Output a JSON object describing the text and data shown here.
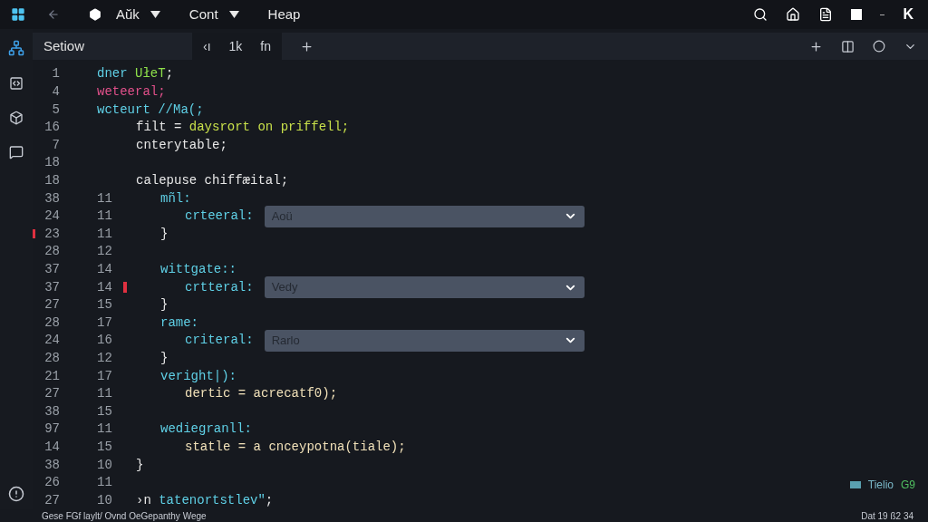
{
  "menu": [
    {
      "label": "Aŭk",
      "caret": true
    },
    {
      "label": "Cont",
      "caret": true
    },
    {
      "label": "Heap",
      "caret": false
    }
  ],
  "window_controls": {
    "close": "K"
  },
  "tabs": [
    {
      "label": "Setiow",
      "selected": false
    }
  ],
  "tab_group": [
    {
      "label": "‹ı"
    },
    {
      "label": "1k"
    },
    {
      "label": "fn"
    }
  ],
  "lines": [
    {
      "n": "1",
      "tokens": [
        {
          "text": "dner ",
          "kind": "keyword"
        },
        {
          "text": "UłeT",
          "kind": "type"
        },
        {
          "text": ";",
          "kind": "plain"
        }
      ]
    },
    {
      "n": "4",
      "tokens": [
        {
          "text": "weteeral;",
          "kind": "accent"
        }
      ]
    },
    {
      "n": "5",
      "tokens": [
        {
          "text": "wcteurt //Ma(;",
          "kind": "keyword"
        }
      ],
      "children": [
        {
          "n": "16",
          "tokens": [
            {
              "text": "filt = ",
              "kind": "plain"
            },
            {
              "text": "daysrort on priffell;",
              "kind": "string"
            }
          ]
        },
        {
          "n": "7",
          "tokens": [
            {
              "text": "cnterytable;",
              "kind": "plain"
            }
          ]
        },
        {
          "n": "18"
        },
        {
          "n": "18",
          "tokens": [
            {
              "text": "calepuse chiffæital;",
              "kind": "plain"
            }
          ],
          "children": [
            {
              "n": "38",
              "n2": "11",
              "tokens": [
                {
                  "text": "mñl:",
                  "kind": "keyword"
                }
              ],
              "children": [
                {
                  "n": "24",
                  "n2": "11",
                  "tokens": [
                    {
                      "text": "crteeral:",
                      "kind": "keyword"
                    }
                  ],
                  "dropdown": {
                    "value": "Aoü"
                  }
                }
              ]
            },
            {
              "n": "23",
              "n2": "11",
              "tokens": [
                {
                  "text": "}",
                  "kind": "plain"
                }
              ],
              "marker": {
                "kind": "gutter"
              }
            },
            {
              "n": "28",
              "n2": "12"
            },
            {
              "n": "37",
              "n2": "14",
              "tokens": [
                {
                  "text": "wittgate::",
                  "kind": "keyword"
                }
              ],
              "children": [
                {
                  "n": "37",
                  "n2": "14",
                  "tokens": [
                    {
                      "text": "crtteral:",
                      "kind": "keyword"
                    }
                  ],
                  "dropdown": {
                    "value": "Vedy"
                  },
                  "marker": {
                    "kind": "inline"
                  }
                }
              ]
            },
            {
              "n": "27",
              "n2": "15",
              "tokens": [
                {
                  "text": "}",
                  "kind": "plain"
                }
              ]
            },
            {
              "n": "28",
              "n2": "17",
              "tokens": [
                {
                  "text": "rame:",
                  "kind": "keyword"
                }
              ],
              "children": [
                {
                  "n": "24",
                  "n2": "16",
                  "tokens": [
                    {
                      "text": "criteral:",
                      "kind": "keyword"
                    }
                  ],
                  "dropdown": {
                    "value": "Rarlo"
                  }
                }
              ]
            },
            {
              "n": "28",
              "n2": "12",
              "tokens": [
                {
                  "text": "}",
                  "kind": "plain"
                }
              ]
            },
            {
              "n": "21",
              "n2": "17",
              "tokens": [
                {
                  "text": "veright|):",
                  "kind": "keyword"
                }
              ],
              "children": [
                {
                  "n": "27",
                  "n2": "11",
                  "tokens": [
                    {
                      "text": "dertic = acrecatf0);",
                      "kind": "value"
                    }
                  ]
                }
              ]
            },
            {
              "n": "38",
              "n2": "15"
            },
            {
              "n": "97",
              "n2": "11",
              "tokens": [
                {
                  "text": "wediegranll:",
                  "kind": "keyword"
                }
              ],
              "children": [
                {
                  "n": "14",
                  "n2": "15",
                  "tokens": [
                    {
                      "text": "statle = a cnceypotna(tiale);",
                      "kind": "value"
                    }
                  ]
                }
              ]
            }
          ]
        },
        {
          "n": "38",
          "n2": "10",
          "tokens": [
            {
              "text": "}",
              "kind": "plain"
            }
          ]
        },
        {
          "n": "26",
          "n2": "11"
        },
        {
          "n": "27",
          "n2": "10",
          "tokens": [
            {
              "text": "›n ",
              "kind": "plain"
            },
            {
              "text": "tatenortstlev\"",
              "kind": "keyword"
            },
            {
              "text": ";",
              "kind": "plain"
            }
          ]
        }
      ]
    }
  ],
  "status_indicator": {
    "label": "Tielio",
    "count": "G9"
  },
  "status_bar": {
    "left": "Gese FGf laylt/ Ovnd OeGepanthy Wege",
    "right": "Dat 19 ß2 34"
  }
}
